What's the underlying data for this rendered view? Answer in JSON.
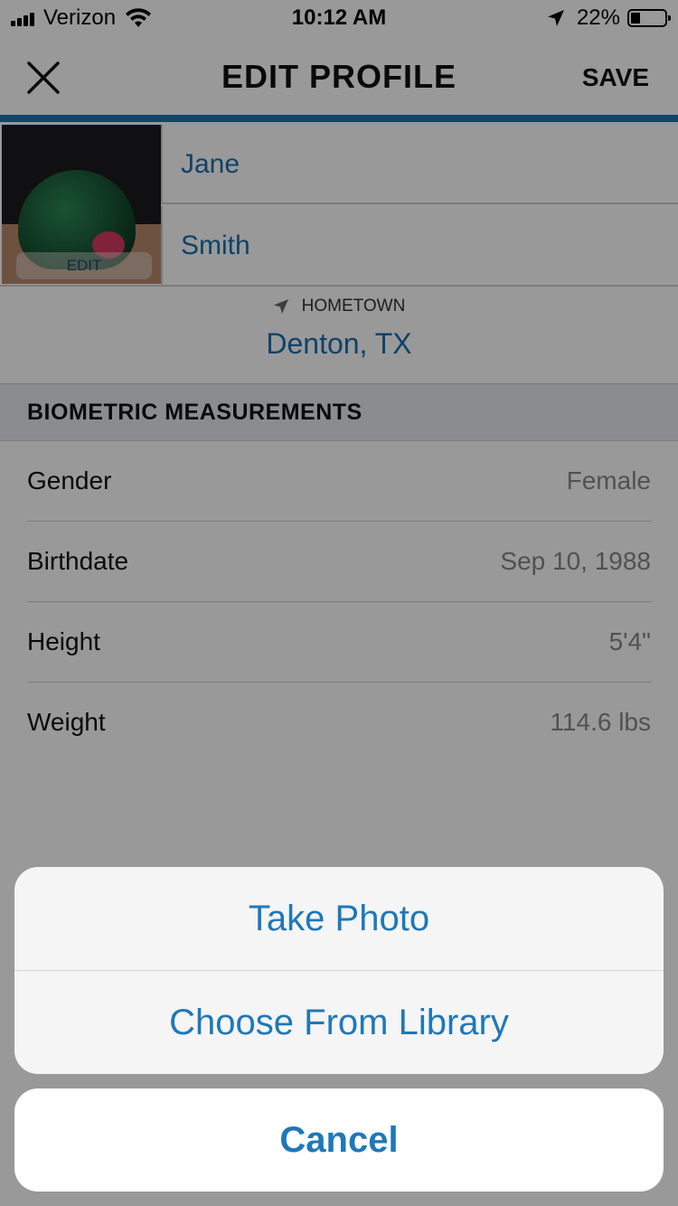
{
  "status_bar": {
    "carrier": "Verizon",
    "time": "10:12 AM",
    "battery_percent": "22%",
    "battery_level": 0.22
  },
  "nav": {
    "title": "EDIT PROFILE",
    "save_label": "SAVE",
    "close_icon": "close-icon",
    "accent_color": "#1d74b5"
  },
  "profile": {
    "photo_edit_label": "EDIT",
    "first_name": "Jane",
    "last_name": "Smith",
    "hometown_label": "HOMETOWN",
    "hometown_value": "Denton, TX"
  },
  "biometrics": {
    "header": "BIOMETRIC MEASUREMENTS",
    "rows": [
      {
        "label": "Gender",
        "value": "Female"
      },
      {
        "label": "Birthdate",
        "value": "Sep 10, 1988"
      },
      {
        "label": "Height",
        "value": "5'4\""
      },
      {
        "label": "Weight",
        "value": "114.6 lbs"
      }
    ]
  },
  "action_sheet": {
    "options": [
      "Take Photo",
      "Choose From Library"
    ],
    "cancel": "Cancel",
    "link_color": "#1f78b8"
  }
}
